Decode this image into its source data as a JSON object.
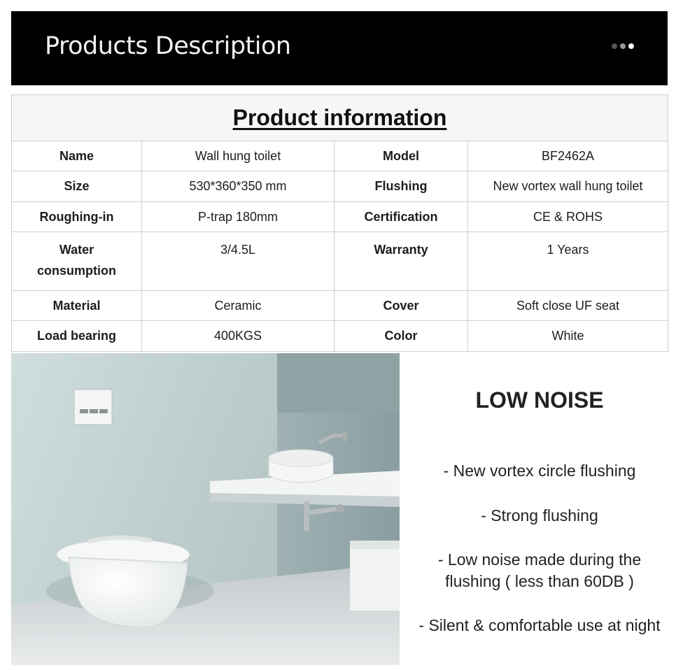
{
  "banner": {
    "title": "Products Description"
  },
  "product_info": {
    "heading": "Product information",
    "rows": [
      {
        "label1": "Name",
        "value1": "Wall hung toilet",
        "label2": "Model",
        "value2": "BF2462A"
      },
      {
        "label1": "Size",
        "value1": "530*360*350 mm",
        "label2": "Flushing",
        "value2": "New vortex wall hung toilet"
      },
      {
        "label1": "Roughing-in",
        "value1": "P-trap 180mm",
        "label2": "Certification",
        "value2": "CE & ROHS"
      },
      {
        "label1": "Water consumption",
        "value1": "3/4.5L",
        "label2": "Warranty",
        "value2": "1 Years"
      },
      {
        "label1": "Material",
        "value1": "Ceramic",
        "label2": "Cover",
        "value2": "Soft close UF seat"
      },
      {
        "label1": "Load bearing",
        "value1": "400KGS",
        "label2": "Color",
        "value2": "White"
      }
    ]
  },
  "feature": {
    "title": "LOW NOISE",
    "items": [
      "- New vortex circle flushing",
      "- Strong flushing",
      "- Low noise made during the flushing ( less than 60DB )",
      "- Silent & comfortable use at night"
    ]
  },
  "colors": {
    "banner_bg": "#000000",
    "wall": "#b9cbc9",
    "table_border": "#cfcfcf"
  }
}
